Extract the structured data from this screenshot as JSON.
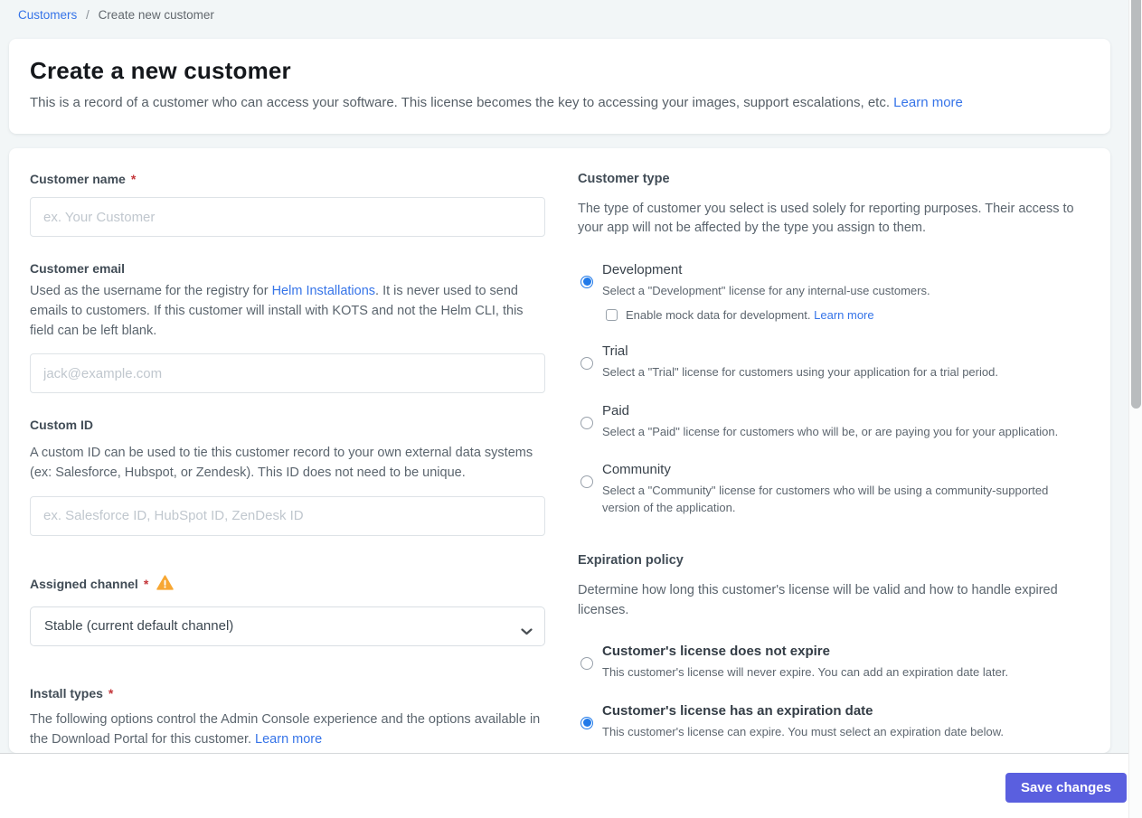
{
  "breadcrumb": {
    "parent": "Customers",
    "separator": "/",
    "current": "Create new customer"
  },
  "header": {
    "title": "Create a new customer",
    "description": "This is a record of a customer who can access your software. This license becomes the key to accessing your images, support escalations, etc.",
    "learn_more": "Learn more"
  },
  "form": {
    "customer_name": {
      "label": "Customer name",
      "required_marker": "*",
      "placeholder": "ex. Your Customer",
      "value": ""
    },
    "customer_email": {
      "label": "Customer email",
      "description_before_link": "Used as the username for the registry for ",
      "link_text": "Helm Installations",
      "description_after_link": ". It is never used to send emails to customers. If this customer will install with KOTS and not the Helm CLI, this field can be left blank.",
      "placeholder": "jack@example.com",
      "value": ""
    },
    "custom_id": {
      "label": "Custom ID",
      "description": "A custom ID can be used to tie this customer record to your own external data systems (ex: Salesforce, Hubspot, or Zendesk). This ID does not need to be unique.",
      "placeholder": "ex. Salesforce ID, HubSpot ID, ZenDesk ID",
      "value": ""
    },
    "assigned_channel": {
      "label": "Assigned channel",
      "required_marker": "*",
      "selected_option": "Stable (current default channel)"
    },
    "install_types": {
      "label": "Install types",
      "required_marker": "*",
      "description": "The following options control the Admin Console experience and the options available in the Download Portal for this customer. ",
      "learn_more": "Learn more"
    }
  },
  "customer_type": {
    "heading": "Customer type",
    "description": "The type of customer you select is used solely for reporting purposes. Their access to your app will not be affected by the type you assign to them.",
    "options": [
      {
        "title": "Development",
        "description": "Select a \"Development\" license for any internal-use customers.",
        "selected": true,
        "checkbox_label": "Enable mock data for development. ",
        "checkbox_link": "Learn more",
        "checkbox_checked": false
      },
      {
        "title": "Trial",
        "description": "Select a \"Trial\" license for customers using your application for a trial period.",
        "selected": false
      },
      {
        "title": "Paid",
        "description": "Select a \"Paid\" license for customers who will be, or are paying you for your application.",
        "selected": false
      },
      {
        "title": "Community",
        "description": "Select a \"Community\" license for customers who will be using a community-supported version of the application.",
        "selected": false
      }
    ]
  },
  "expiration_policy": {
    "heading": "Expiration policy",
    "description": "Determine how long this customer's license will be valid and how to handle expired licenses.",
    "options": [
      {
        "title": "Customer's license does not expire",
        "description": "This customer's license will never expire. You can add an expiration date later.",
        "selected": false
      },
      {
        "title": "Customer's license has an expiration date",
        "description": "This customer's license can expire. You must select an expiration date below.",
        "selected": true
      }
    ]
  },
  "footer": {
    "save_label": "Save changes"
  },
  "colors": {
    "accent_blue": "#217ae9",
    "link_blue": "#3674e8",
    "button_indigo": "#5a5fdf",
    "warning_amber": "#f7a733",
    "required_red": "#c4373b"
  }
}
